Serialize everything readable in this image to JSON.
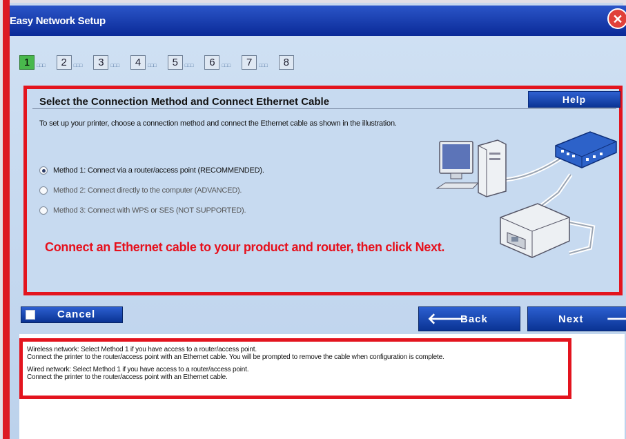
{
  "window": {
    "title": "Easy Network Setup"
  },
  "steps": [
    "1",
    "2",
    "3",
    "4",
    "5",
    "6",
    "7",
    "8"
  ],
  "steps_dots": "□□□",
  "panel": {
    "title": "Select the Connection Method and Connect Ethernet Cable",
    "help_label": "Help",
    "description": "To set up your printer, choose a connection method and connect the Ethernet cable as shown in the illustration.",
    "methods": [
      {
        "label": "Method 1: Connect via a router/access point (RECOMMENDED).",
        "selected": true
      },
      {
        "label": "Method 2: Connect directly to the computer (ADVANCED).",
        "selected": false
      },
      {
        "label": "Method 3: Connect with WPS or SES (NOT SUPPORTED).",
        "selected": false
      }
    ],
    "instruction": "Connect an Ethernet cable to your product and router, then click Next."
  },
  "buttons": {
    "cancel": "Cancel",
    "back": "Back",
    "next": "Next",
    "back_arrow": "🡐",
    "next_arrow": "🡒"
  },
  "info": {
    "wireless_1": "Wireless network: Select Method 1 if you have access to a router/access point.",
    "wireless_2": "Connect the printer to the router/access point with an Ethernet cable. You will be prompted to remove the cable when configuration is complete.",
    "wired_1": "Wired network: Select Method 1 if you have access to a router/access point.",
    "wired_2": "Connect the printer to the router/access point with an Ethernet cable."
  },
  "colors": {
    "accent_red": "#e3141e",
    "title_blue": "#0a2a97",
    "active_step": "#49b84c"
  },
  "icons": {
    "close": "close-icon",
    "back": "arrow-left-icon",
    "next": "arrow-right-icon"
  }
}
